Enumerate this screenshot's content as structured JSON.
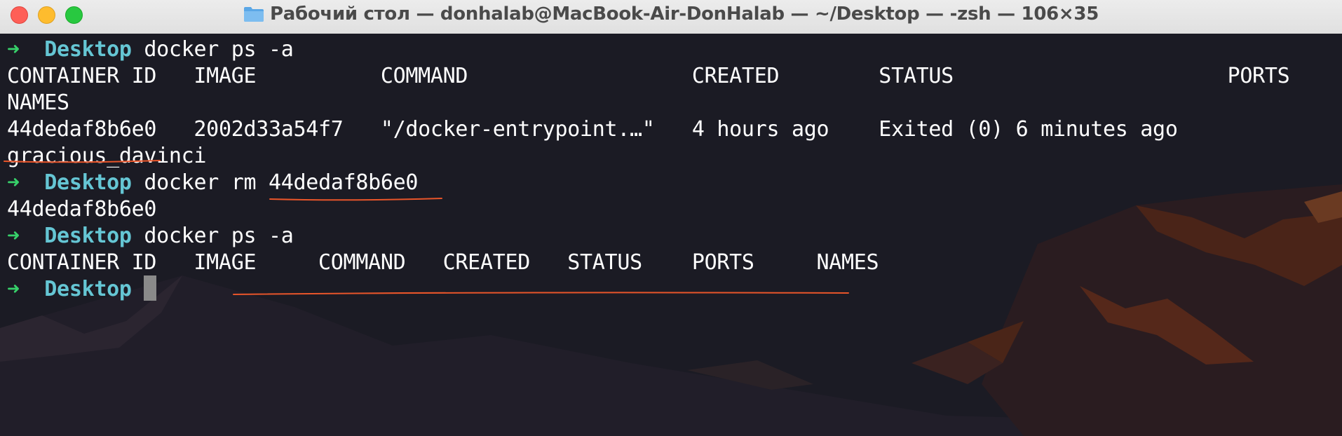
{
  "window": {
    "title": "Рабочий стол — donhalab@MacBook-Air-DonHalab — ~/Desktop — -zsh — 106×35",
    "icon": "folder-icon",
    "accent": "#65c6d4",
    "prompt_arrow_color": "#37d16a",
    "annotation_color": "#e8552a"
  },
  "terminal": {
    "prompt_arrow": "➜",
    "prompt_dir": "Desktop",
    "lines": [
      {
        "type": "prompt",
        "command": "docker ps -a"
      },
      {
        "type": "output",
        "text": "CONTAINER ID   IMAGE          COMMAND                  CREATED        STATUS                      PORTS"
      },
      {
        "type": "output",
        "text": "NAMES"
      },
      {
        "type": "output",
        "text": "44dedaf8b6e0   2002d33a54f7   \"/docker-entrypoint.…\"   4 hours ago    Exited (0) 6 minutes ago"
      },
      {
        "type": "output",
        "text": "gracious_davinci"
      },
      {
        "type": "prompt",
        "command": "docker rm 44dedaf8b6e0"
      },
      {
        "type": "output",
        "text": "44dedaf8b6e0"
      },
      {
        "type": "prompt",
        "command": "docker ps -a"
      },
      {
        "type": "output",
        "text": "CONTAINER ID   IMAGE     COMMAND   CREATED   STATUS    PORTS     NAMES"
      },
      {
        "type": "prompt",
        "command": ""
      }
    ]
  }
}
